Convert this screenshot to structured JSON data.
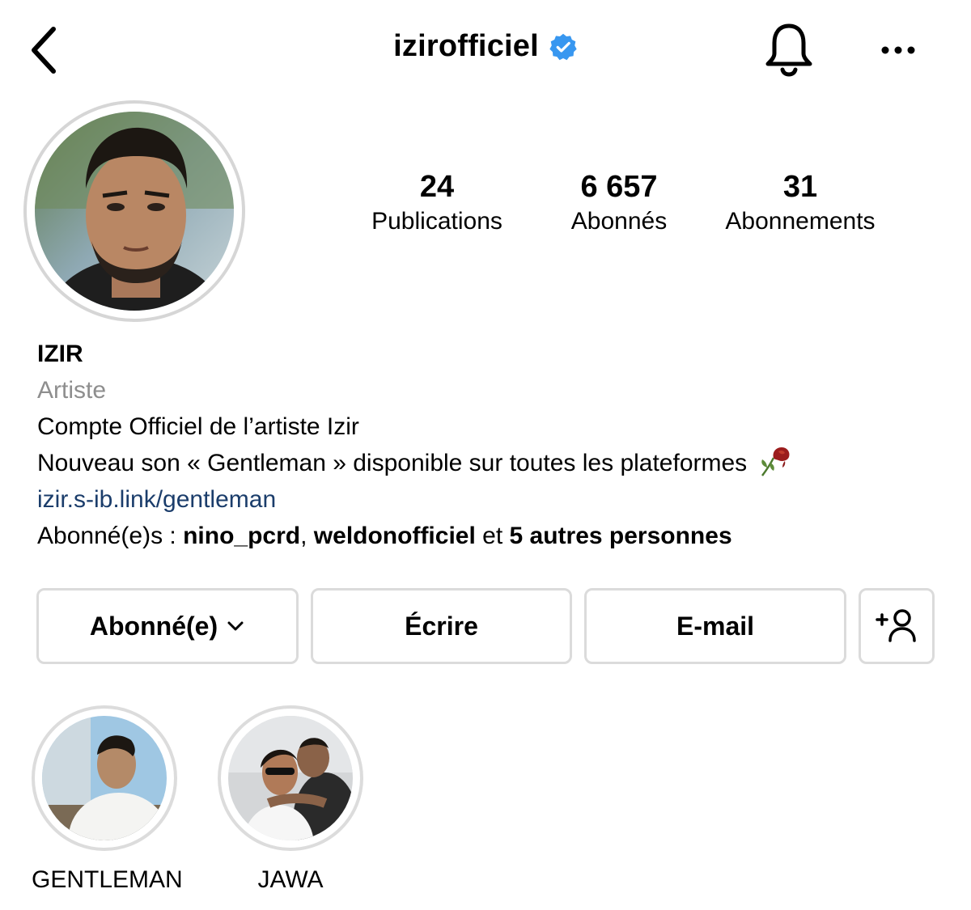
{
  "header": {
    "username": "izirofficiel",
    "icons": {
      "back": "chevron-left-icon",
      "verified": "verified-badge-icon",
      "bell": "bell-icon",
      "more": "more-horizontal-icon"
    },
    "verified_color": "#3897f0"
  },
  "stats": [
    {
      "value": "24",
      "label": "Publications"
    },
    {
      "value": "6 657",
      "label": "Abonnés"
    },
    {
      "value": "31",
      "label": "Abonnements"
    }
  ],
  "bio": {
    "name": "IZIR",
    "category": "Artiste",
    "line1": "Compte Officiel de l’artiste Izir",
    "line2": "Nouveau son « Gentleman » disponible sur toutes les plateformes",
    "line2_emoji": "wilted-rose-icon",
    "link": "izir.s-ib.link/gentleman",
    "followed_by_prefix": "Abonné(e)s : ",
    "followed_by_user1": "nino_pcrd",
    "followed_by_sep": ", ",
    "followed_by_user2": "weldonofficiel",
    "followed_by_mid": " et ",
    "followed_by_others": "5 autres personnes",
    "link_color": "#1b3d6b"
  },
  "actions": {
    "following_label": "Abonné(e)",
    "message_label": "Écrire",
    "email_label": "E-mail",
    "add_user_icon": "add-user-icon"
  },
  "highlights": [
    {
      "label": "GENTLEMAN"
    },
    {
      "label": "JAWA"
    }
  ]
}
